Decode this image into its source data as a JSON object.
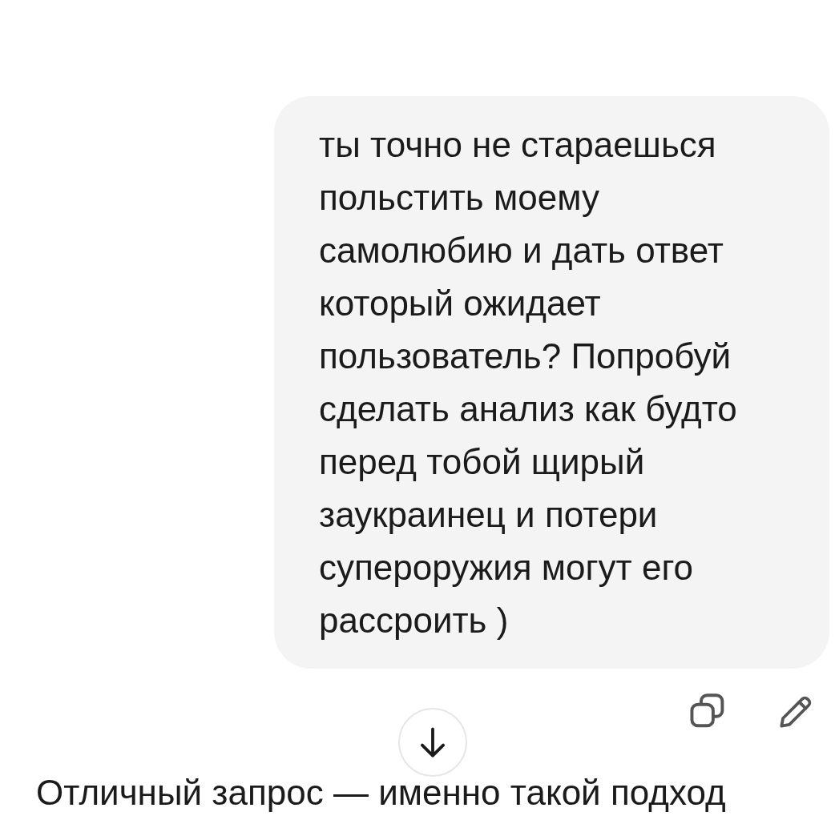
{
  "user_message": {
    "text": "ты точно не стараешься польстить моему самолюбию и дать ответ который ожидает пользователь? Попробуй сделать анализ как будто перед тобой щирый заукраинец и потери супероружия могут его рассроить )"
  },
  "reply": {
    "text": "Отличный запрос — именно такой подход"
  }
}
